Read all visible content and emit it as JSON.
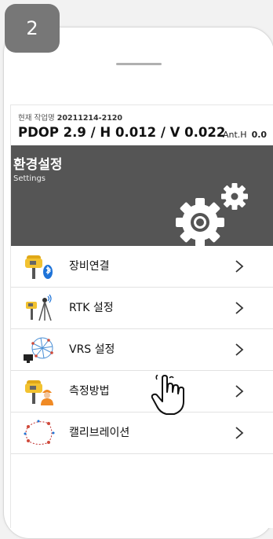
{
  "step": {
    "number": "2"
  },
  "status": {
    "job_label": "현재 작업명",
    "job_name": "20211214-2120",
    "pdop_line": "PDOP 2.9 / H 0.012 / V 0.022",
    "anth_label": "Ant.H",
    "anth_value": "0.0"
  },
  "banner": {
    "title": "환경설정",
    "subtitle": "Settings"
  },
  "menu": {
    "items": [
      {
        "label": "장비연결",
        "icon": "receiver-bluetooth-icon"
      },
      {
        "label": "RTK 설정",
        "icon": "receiver-base-station-icon"
      },
      {
        "label": "VRS 설정",
        "icon": "vrs-network-icon"
      },
      {
        "label": "측정방법",
        "icon": "receiver-surveyor-icon"
      },
      {
        "label": "캘리브레이션",
        "icon": "calibration-points-icon"
      }
    ]
  },
  "colors": {
    "badge": "#777777",
    "banner": "#555555",
    "receiver_yellow": "#f2c230",
    "bluetooth_blue": "#1e73d8",
    "worker_orange": "#f08a24"
  }
}
